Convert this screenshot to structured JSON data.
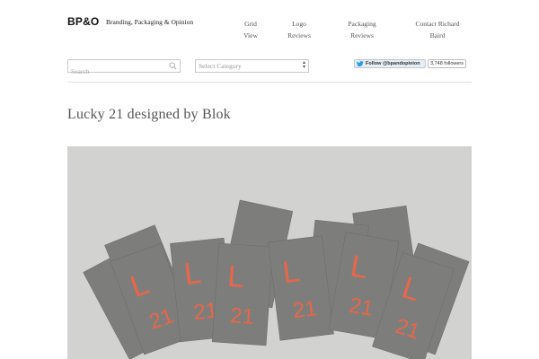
{
  "header": {
    "logo": "BP&O",
    "tagline": "Branding, Packaging & Opinion",
    "nav": {
      "grid_view": [
        "Grid",
        "View"
      ],
      "logo_reviews": [
        "Logo",
        "Reviews"
      ],
      "packaging_reviews": [
        "Packaging",
        "Reviews"
      ],
      "contact": [
        "Contact Richard",
        "Baird"
      ]
    }
  },
  "toolbar": {
    "search_placeholder": "Search",
    "category_select": "Select Category",
    "twitter_follow": "Follow @bpandopinion",
    "followers": "3,748 followers"
  },
  "post": {
    "title": "Lucky 21 designed by Blok",
    "card_number": "21",
    "card_letter": "L",
    "colors": {
      "card": "#7d7e7c",
      "print": "#e8664a",
      "background": "#d2d3d0"
    }
  }
}
